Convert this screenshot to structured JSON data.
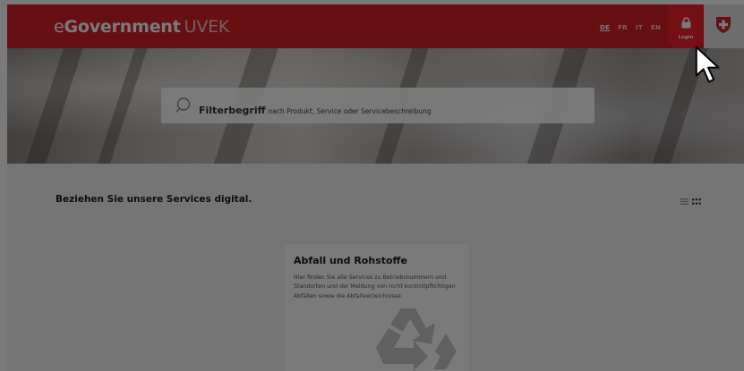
{
  "header": {
    "brand_prefix": "e",
    "brand_main": "Government",
    "brand_suffix": "UVEK",
    "languages": [
      {
        "code": "DE",
        "active": true
      },
      {
        "code": "FR",
        "active": false
      },
      {
        "code": "IT",
        "active": false
      },
      {
        "code": "EN",
        "active": false
      }
    ],
    "login_label": "Login"
  },
  "search": {
    "placeholder_strong": "Filterbegriff",
    "placeholder_rest": "nach Produkt, Service oder Servicebeschreibung"
  },
  "main": {
    "intro": "Beziehen Sie unsere Services digital.",
    "cards": [
      {
        "title": "Abfall und Rohstoffe",
        "description": "Hier finden Sie alle Services zu Betriebsnummern und Standorten und der Meldung von nicht kontrollpflichtigen Abfällen sowie die Abfallverzeichnisse.",
        "icon": "recycle-icon"
      }
    ]
  },
  "colors": {
    "brand_red": "#d8232a",
    "login_red": "#f0202c",
    "overlay": "rgba(0,0,0,0.52)"
  }
}
